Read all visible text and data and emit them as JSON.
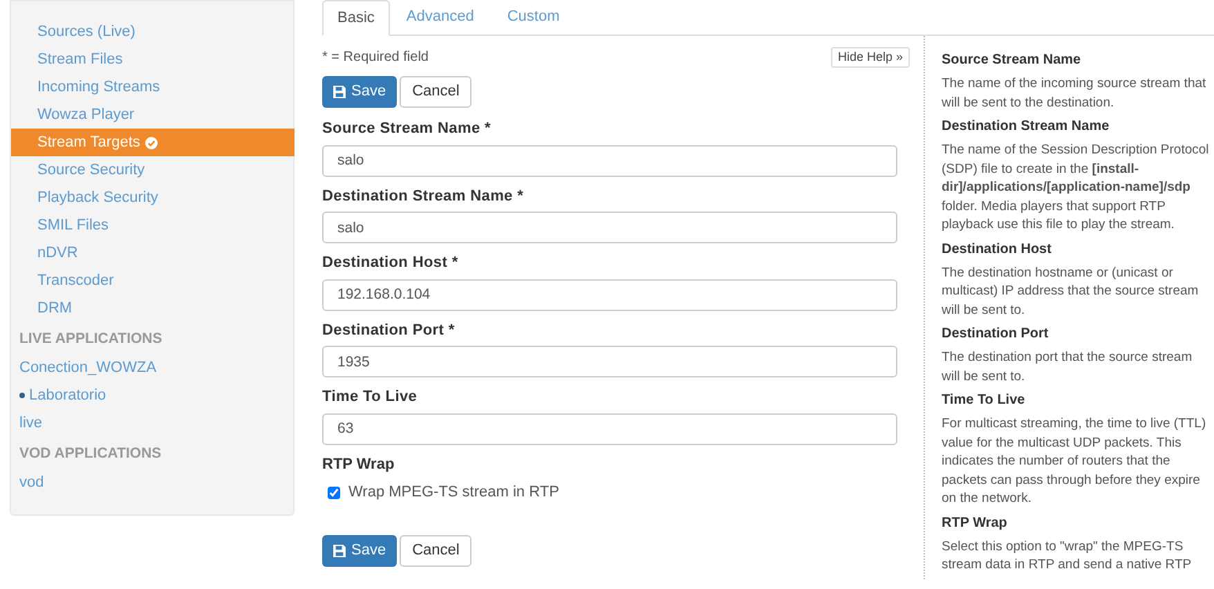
{
  "sidebar": {
    "items": [
      {
        "label": "Sources (Live)",
        "selected": false,
        "kind": "link"
      },
      {
        "label": "Stream Files",
        "selected": false,
        "kind": "link"
      },
      {
        "label": "Incoming Streams",
        "selected": false,
        "kind": "link"
      },
      {
        "label": "Wowza Player",
        "selected": false,
        "kind": "link"
      },
      {
        "label": "Stream Targets",
        "selected": true,
        "kind": "link"
      },
      {
        "label": "Source Security",
        "selected": false,
        "kind": "link"
      },
      {
        "label": "Playback Security",
        "selected": false,
        "kind": "link"
      },
      {
        "label": "SMIL Files",
        "selected": false,
        "kind": "link"
      },
      {
        "label": "nDVR",
        "selected": false,
        "kind": "link"
      },
      {
        "label": "Transcoder",
        "selected": false,
        "kind": "link"
      },
      {
        "label": "DRM",
        "selected": false,
        "kind": "link"
      },
      {
        "label": "LIVE APPLICATIONS",
        "kind": "header"
      },
      {
        "label": "Conection_WOWZA",
        "kind": "app",
        "current": false
      },
      {
        "label": "Laboratorio",
        "kind": "app",
        "current": true
      },
      {
        "label": "live",
        "kind": "app",
        "current": false
      },
      {
        "label": "VOD APPLICATIONS",
        "kind": "header"
      },
      {
        "label": "vod",
        "kind": "app",
        "current": false
      }
    ]
  },
  "tabs": [
    {
      "label": "Basic",
      "selected": true
    },
    {
      "label": "Advanced",
      "selected": false
    },
    {
      "label": "Custom",
      "selected": false
    }
  ],
  "required_note": "* = Required field",
  "hide_help": "Hide Help »",
  "top_buttons": {
    "save": "Save",
    "cancel": "Cancel"
  },
  "fields": [
    {
      "label": "Source Stream Name *",
      "value": "salo",
      "kind": "text"
    },
    {
      "label": "Destination Stream Name *",
      "value": "salo",
      "kind": "text"
    },
    {
      "label": "Destination Host *",
      "value": "192.168.0.104",
      "kind": "text"
    },
    {
      "label": "Destination Port *",
      "value": "1935",
      "kind": "text"
    },
    {
      "label": "Time To Live",
      "value": "63",
      "kind": "text"
    },
    {
      "label": "RTP Wrap",
      "kind": "checkbox",
      "option": "Wrap MPEG-TS stream in RTP",
      "checked": true
    }
  ],
  "bottom_buttons": {
    "save": "Save",
    "cancel": "Cancel"
  },
  "help": [
    {
      "title": "Source Stream Name",
      "text": "The name of the incoming source stream that will be sent to the destination."
    },
    {
      "title": "Destination Stream Name",
      "text": "The name of the Session Description Protocol (SDP) file to create in the **[install-dir]/applications/[application-name]/sdp** folder. Media players that support RTP playback use this file to play the stream."
    },
    {
      "title": "Destination Host",
      "text": "The destination hostname or (unicast or multicast) IP address that the source stream will be sent to."
    },
    {
      "title": "Destination Port",
      "text": "The destination port that the source stream will be sent to."
    },
    {
      "title": "Time To Live",
      "text": "For multicast streaming, the time to live (TTL) value for the multicast UDP packets. This indicates the number of routers that the packets can pass through before they expire on the network."
    },
    {
      "title": "RTP Wrap",
      "text": "Select this option to \"wrap\" the MPEG-TS stream data in RTP and send a native RTP"
    }
  ]
}
